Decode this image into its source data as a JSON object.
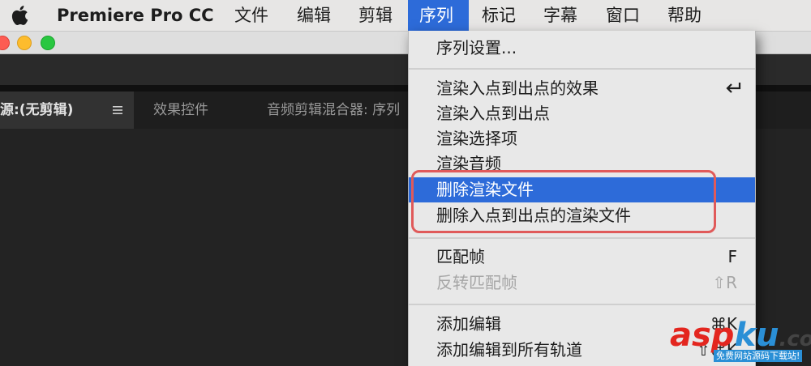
{
  "menubar": {
    "app_name": "Premiere Pro CC",
    "menus": [
      "文件",
      "编辑",
      "剪辑",
      "序列",
      "标记",
      "字幕",
      "窗口",
      "帮助"
    ],
    "active_menu": "序列"
  },
  "panel": {
    "tabs": [
      "源:(无剪辑)",
      "效果控件",
      "音频剪辑混合器: 序列"
    ],
    "active_tab": "源:(无剪辑)"
  },
  "dropdown": {
    "items": [
      {
        "label": "序列设置...",
        "shortcut": "",
        "enabled": true
      },
      {
        "label": "渲染入点到出点的效果",
        "shortcut": "",
        "icon": "return-key-icon",
        "enabled": true
      },
      {
        "label": "渲染入点到出点",
        "shortcut": "",
        "enabled": true
      },
      {
        "label": "渲染选择项",
        "shortcut": "",
        "enabled": true
      },
      {
        "label": "渲染音频",
        "shortcut": "",
        "enabled": true
      },
      {
        "label": "删除渲染文件",
        "shortcut": "",
        "enabled": true,
        "highlighted": true
      },
      {
        "label": "删除入点到出点的渲染文件",
        "shortcut": "",
        "enabled": true
      },
      {
        "label": "匹配帧",
        "shortcut": "F",
        "enabled": true
      },
      {
        "label": "反转匹配帧",
        "shortcut": "⇧R",
        "enabled": false
      },
      {
        "label": "添加编辑",
        "shortcut": "⌘K",
        "enabled": true
      },
      {
        "label": "添加编辑到所有轨道",
        "shortcut": "⇧⌘K",
        "enabled": true
      }
    ]
  },
  "watermark": {
    "logo_part1": "asp",
    "logo_part2": "ku",
    "logo_part3": ".com",
    "tagline": "免费网站源码下载站!"
  },
  "colors": {
    "accent": "#2d6bd9",
    "annotation": "#e05a5a",
    "menubar_bg": "#e7e6e5",
    "dark_bg": "#232323"
  }
}
